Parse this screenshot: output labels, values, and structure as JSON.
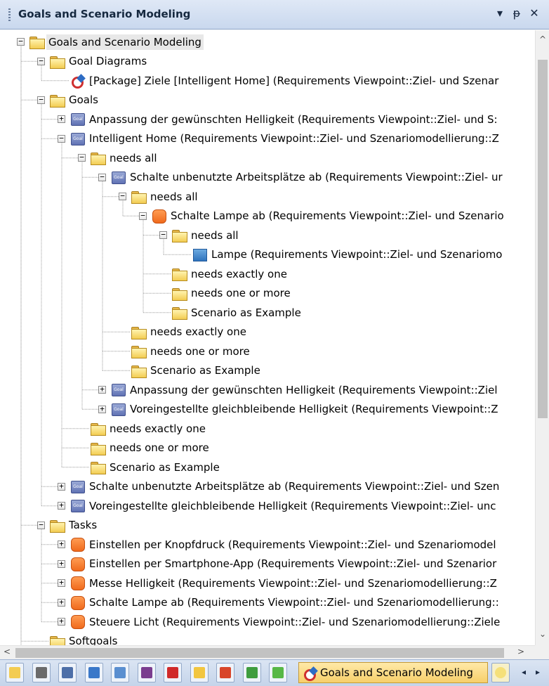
{
  "window": {
    "title": "Goals and Scenario Modeling",
    "buttons": {
      "menu": "▾",
      "pin": "ᵽ",
      "close": "✕"
    }
  },
  "tree": [
    {
      "depth": 0,
      "type": "folder",
      "expander": "minus",
      "label": "Goals and Scenario Modeling",
      "selected": true
    },
    {
      "depth": 1,
      "type": "folder",
      "expander": "minus",
      "label": "Goal Diagrams"
    },
    {
      "depth": 2,
      "type": "diagram",
      "expander": "none",
      "label": "[Package] Ziele [Intelligent Home] (Requirements Viewpoint::Ziel- und Szenar"
    },
    {
      "depth": 1,
      "type": "folder",
      "expander": "minus",
      "label": "Goals"
    },
    {
      "depth": 2,
      "type": "goal",
      "expander": "plus",
      "label": "Anpassung der gewünschten Helligkeit (Requirements Viewpoint::Ziel- und S:"
    },
    {
      "depth": 2,
      "type": "goal",
      "expander": "minus",
      "label": "Intelligent Home (Requirements Viewpoint::Ziel- und Szenariomodellierung::Z"
    },
    {
      "depth": 3,
      "type": "folder",
      "expander": "minus",
      "label": "needs all"
    },
    {
      "depth": 4,
      "type": "goal",
      "expander": "minus",
      "label": "Schalte unbenutzte Arbeitsplätze ab (Requirements Viewpoint::Ziel- ur"
    },
    {
      "depth": 5,
      "type": "folder",
      "expander": "minus",
      "label": "needs all"
    },
    {
      "depth": 6,
      "type": "task",
      "expander": "minus",
      "label": "Schalte Lampe ab (Requirements Viewpoint::Ziel- und Szenario"
    },
    {
      "depth": 7,
      "type": "folder",
      "expander": "minus",
      "label": "needs all"
    },
    {
      "depth": 8,
      "type": "element",
      "expander": "none",
      "label": "Lampe (Requirements Viewpoint::Ziel- und Szenariomo"
    },
    {
      "depth": 7,
      "type": "folder",
      "expander": "none",
      "label": "needs exactly one"
    },
    {
      "depth": 7,
      "type": "folder",
      "expander": "none",
      "label": "needs one or more"
    },
    {
      "depth": 7,
      "type": "folder",
      "expander": "none",
      "label": "Scenario as Example"
    },
    {
      "depth": 5,
      "type": "folder",
      "expander": "none",
      "label": "needs exactly one"
    },
    {
      "depth": 5,
      "type": "folder",
      "expander": "none",
      "label": "needs one or more"
    },
    {
      "depth": 5,
      "type": "folder",
      "expander": "none",
      "label": "Scenario as Example"
    },
    {
      "depth": 4,
      "type": "goal",
      "expander": "plus",
      "label": "Anpassung der gewünschten Helligkeit (Requirements Viewpoint::Ziel"
    },
    {
      "depth": 4,
      "type": "goal",
      "expander": "plus",
      "label": "Voreingestellte gleichbleibende Helligkeit (Requirements Viewpoint::Z"
    },
    {
      "depth": 3,
      "type": "folder",
      "expander": "none",
      "label": "needs exactly one"
    },
    {
      "depth": 3,
      "type": "folder",
      "expander": "none",
      "label": "needs one or more"
    },
    {
      "depth": 3,
      "type": "folder",
      "expander": "none",
      "label": "Scenario as Example"
    },
    {
      "depth": 2,
      "type": "goal",
      "expander": "plus",
      "label": "Schalte unbenutzte Arbeitsplätze ab (Requirements Viewpoint::Ziel- und Szen"
    },
    {
      "depth": 2,
      "type": "goal",
      "expander": "plus",
      "label": "Voreingestellte gleichbleibende Helligkeit (Requirements Viewpoint::Ziel- unc"
    },
    {
      "depth": 1,
      "type": "folder",
      "expander": "minus",
      "label": "Tasks"
    },
    {
      "depth": 2,
      "type": "task",
      "expander": "plus",
      "label": "Einstellen per Knopfdruck (Requirements Viewpoint::Ziel- und Szenariomodel"
    },
    {
      "depth": 2,
      "type": "task",
      "expander": "plus",
      "label": "Einstellen per Smartphone-App (Requirements Viewpoint::Ziel- und Szenarior"
    },
    {
      "depth": 2,
      "type": "task",
      "expander": "plus",
      "label": "Messe Helligkeit (Requirements Viewpoint::Ziel- und Szenariomodellierung::Z"
    },
    {
      "depth": 2,
      "type": "task",
      "expander": "plus",
      "label": "Schalte Lampe ab (Requirements Viewpoint::Ziel- und Szenariomodellierung::"
    },
    {
      "depth": 2,
      "type": "task",
      "expander": "plus",
      "label": "Steuere Licht (Requirements Viewpoint::Ziel- und Szenariomodellierung::Ziele"
    },
    {
      "depth": 1,
      "type": "folder",
      "expander": "none",
      "label": "Softgoals"
    }
  ],
  "scrollbars": {
    "up": "^",
    "down": "⌄",
    "left": "<",
    "right": ">"
  },
  "tabbar": {
    "tabs": [
      {
        "icon": "folder-icon",
        "color": "#f3cc52"
      },
      {
        "icon": "pencil-icon",
        "color": "#6b6b6b"
      },
      {
        "icon": "window-icon",
        "color": "#4d6fa8"
      },
      {
        "icon": "hierarchy-icon",
        "color": "#3a78c9"
      },
      {
        "icon": "panel-icon",
        "color": "#5a8fd0"
      },
      {
        "icon": "book-icon",
        "color": "#7a3d8f"
      },
      {
        "icon": "stack-icon",
        "color": "#d02a2a"
      },
      {
        "icon": "yellow-box-icon",
        "color": "#f2c640"
      },
      {
        "icon": "arrow-flow-icon",
        "color": "#d8452a"
      },
      {
        "icon": "puzzle-icon",
        "color": "#3f9d3f"
      },
      {
        "icon": "add-icon",
        "color": "#57b846"
      }
    ],
    "active_label": "Goals and Scenario Modeling",
    "overflow_left": "◂",
    "overflow_right": "▸"
  }
}
